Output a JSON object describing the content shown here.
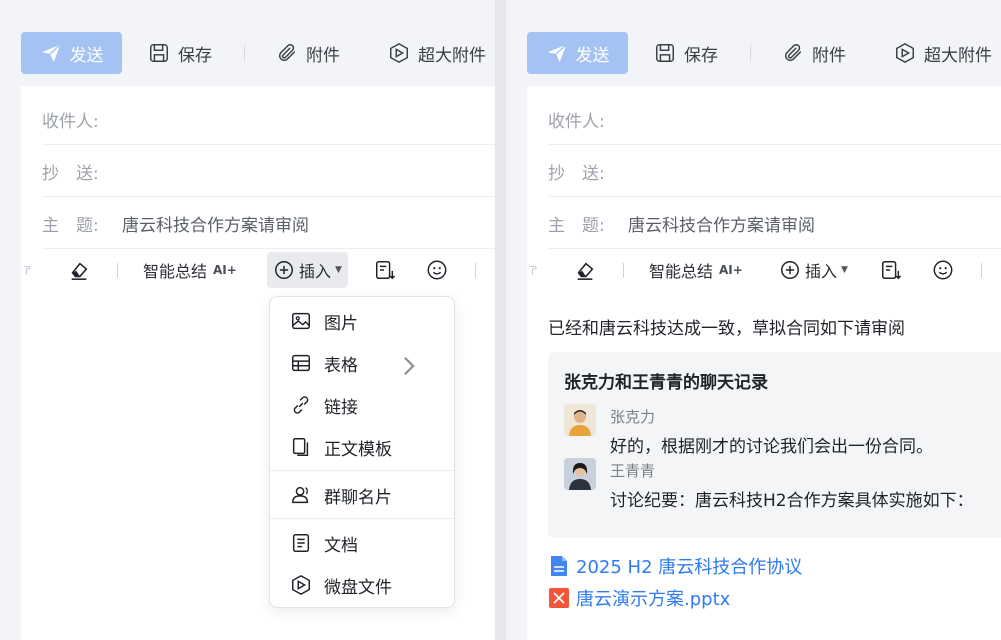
{
  "toolbar": {
    "send": "发送",
    "save": "保存",
    "attach": "附件",
    "big_attach": "超大附件"
  },
  "fields": {
    "to_label": "收件人:",
    "cc_label": "抄　送:",
    "subject_label": "主　题:",
    "subject_value": "唐云科技合作方案请审阅"
  },
  "format_bar": {
    "summary": "智能总结",
    "ai_badge": "AI+",
    "insert": "插入"
  },
  "insert_menu": [
    {
      "label": "图片",
      "icon": "image-icon"
    },
    {
      "label": "表格",
      "icon": "table-icon",
      "has_submenu": true
    },
    {
      "label": "链接",
      "icon": "link-icon"
    },
    {
      "label": "正文模板",
      "icon": "template-icon"
    },
    {
      "label": "群聊名片",
      "icon": "group-card-icon"
    },
    {
      "label": "文档",
      "icon": "doc-icon"
    },
    {
      "label": "微盘文件",
      "icon": "weidisk-icon"
    }
  ],
  "body": {
    "intro": "已经和唐云科技达成一致，草拟合同如下请审阅",
    "chat": {
      "title": "张克力和王青青的聊天记录",
      "messages": [
        {
          "sender": "张克力",
          "text": "好的，根据刚才的讨论我们会出一份合同。"
        },
        {
          "sender": "王青青",
          "text": "讨论纪要：唐云科技H2合作方案具体实施如下："
        }
      ]
    },
    "files": [
      {
        "name": "2025 H2 唐云科技合作协议",
        "type": "doc"
      },
      {
        "name": "唐云演示方案.pptx",
        "type": "pptx"
      }
    ]
  },
  "colors": {
    "send_bg": "#a4c3f3",
    "link": "#2f7bf2",
    "doc_icon": "#3f86ee",
    "ppt_icon": "#f2553a"
  }
}
